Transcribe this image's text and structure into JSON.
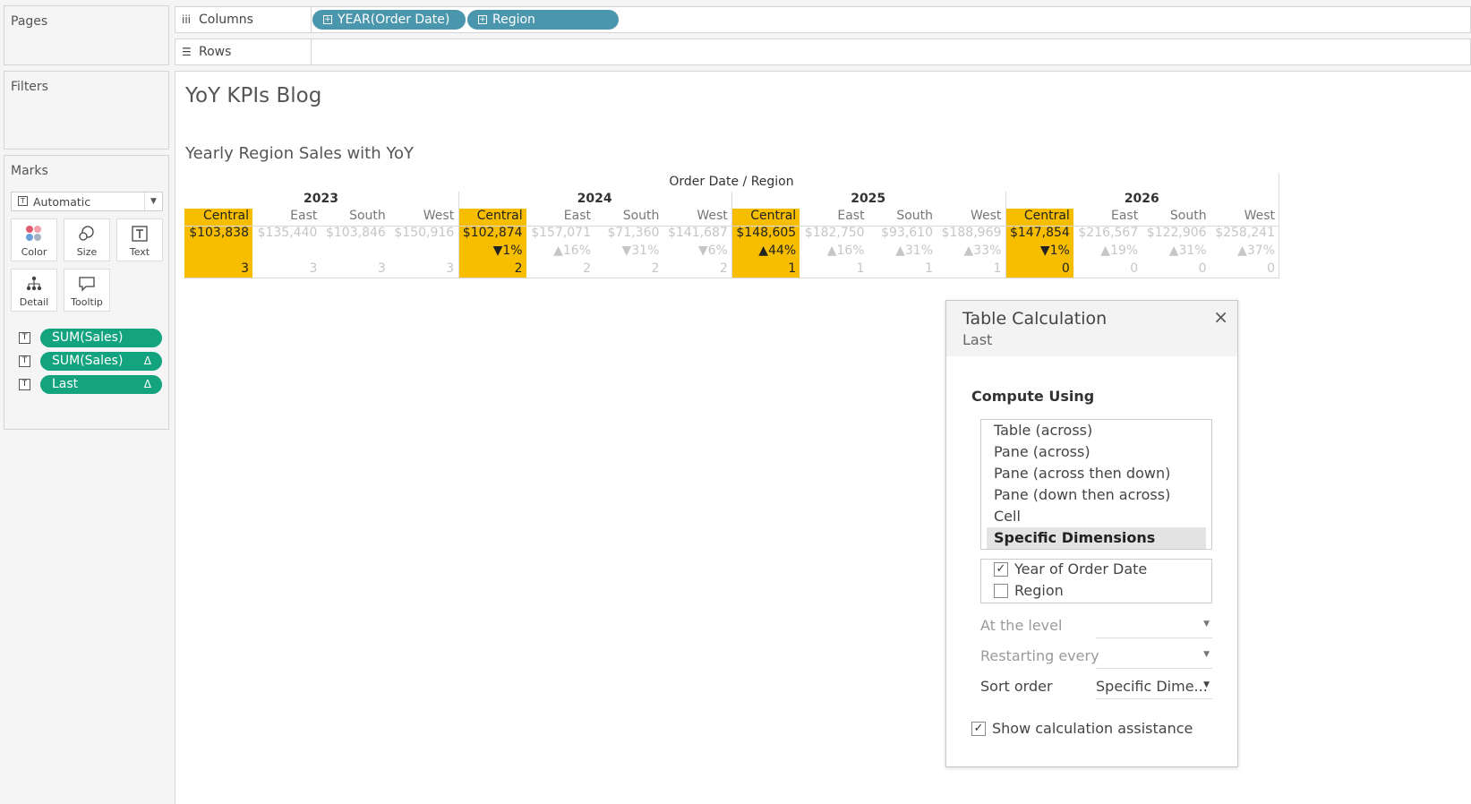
{
  "left": {
    "pages_title": "Pages",
    "filters_title": "Filters",
    "marks_title": "Marks",
    "mark_type": "Automatic",
    "mark_buttons": [
      {
        "label": "Color",
        "icon": "color-icon"
      },
      {
        "label": "Size",
        "icon": "size-icon"
      },
      {
        "label": "Text",
        "icon": "text-icon"
      },
      {
        "label": "Detail",
        "icon": "detail-icon"
      },
      {
        "label": "Tooltip",
        "icon": "tooltip-icon"
      }
    ],
    "pills": [
      {
        "label": "SUM(Sales)",
        "delta": "",
        "mark": "T"
      },
      {
        "label": "SUM(Sales)",
        "delta": "Δ",
        "mark": "T"
      },
      {
        "label": "Last",
        "delta": "Δ",
        "mark": "T"
      }
    ]
  },
  "shelves": {
    "columns_label": "Columns",
    "columns_icon": "iii",
    "rows_label": "Rows",
    "rows_icon": "☰",
    "column_pills": [
      "YEAR(Order Date)",
      "Region"
    ],
    "pill_plus": "+"
  },
  "view": {
    "title": "YoY KPIs Blog",
    "subtitle": "Yearly Region Sales with YoY",
    "header": "Order Date  /  Region",
    "highlight_color": "#f7be00",
    "years": [
      {
        "year": "2023",
        "cells": [
          {
            "region": "Central",
            "sales": "$103,838",
            "yoy": "",
            "last": "3",
            "highlight": true
          },
          {
            "region": "East",
            "sales": "$135,440",
            "yoy": "",
            "last": "3",
            "highlight": false
          },
          {
            "region": "South",
            "sales": "$103,846",
            "yoy": "",
            "last": "3",
            "highlight": false
          },
          {
            "region": "West",
            "sales": "$150,916",
            "yoy": "",
            "last": "3",
            "highlight": false
          }
        ]
      },
      {
        "year": "2024",
        "cells": [
          {
            "region": "Central",
            "sales": "$102,874",
            "yoy": "▼1%",
            "last": "2",
            "highlight": true
          },
          {
            "region": "East",
            "sales": "$157,071",
            "yoy": "▲16%",
            "last": "2",
            "highlight": false
          },
          {
            "region": "South",
            "sales": "$71,360",
            "yoy": "▼31%",
            "last": "2",
            "highlight": false
          },
          {
            "region": "West",
            "sales": "$141,687",
            "yoy": "▼6%",
            "last": "2",
            "highlight": false
          }
        ]
      },
      {
        "year": "2025",
        "cells": [
          {
            "region": "Central",
            "sales": "$148,605",
            "yoy": "▲44%",
            "last": "1",
            "highlight": true
          },
          {
            "region": "East",
            "sales": "$182,750",
            "yoy": "▲16%",
            "last": "1",
            "highlight": false
          },
          {
            "region": "South",
            "sales": "$93,610",
            "yoy": "▲31%",
            "last": "1",
            "highlight": false
          },
          {
            "region": "West",
            "sales": "$188,969",
            "yoy": "▲33%",
            "last": "1",
            "highlight": false
          }
        ]
      },
      {
        "year": "2026",
        "cells": [
          {
            "region": "Central",
            "sales": "$147,854",
            "yoy": "▼1%",
            "last": "0",
            "highlight": true
          },
          {
            "region": "East",
            "sales": "$216,567",
            "yoy": "▲19%",
            "last": "0",
            "highlight": false
          },
          {
            "region": "South",
            "sales": "$122,906",
            "yoy": "▲31%",
            "last": "0",
            "highlight": false
          },
          {
            "region": "West",
            "sales": "$258,241",
            "yoy": "▲37%",
            "last": "0",
            "highlight": false
          }
        ]
      }
    ]
  },
  "dialog": {
    "title": "Table Calculation",
    "subtitle": "Last",
    "close": "×",
    "compute_label": "Compute Using",
    "options": [
      "Table (across)",
      "Pane (across)",
      "Pane (across then down)",
      "Pane (down then across)",
      "Cell",
      "Specific Dimensions"
    ],
    "selected_option": "Specific Dimensions",
    "dimensions": [
      {
        "label": "Year of Order Date",
        "checked": true
      },
      {
        "label": "Region",
        "checked": false
      }
    ],
    "at_level_label": "At the level",
    "restarting_label": "Restarting every",
    "sort_label": "Sort order",
    "sort_value": "Specific Dime...",
    "assist_label": "Show calculation assistance",
    "assist_checked": true
  }
}
